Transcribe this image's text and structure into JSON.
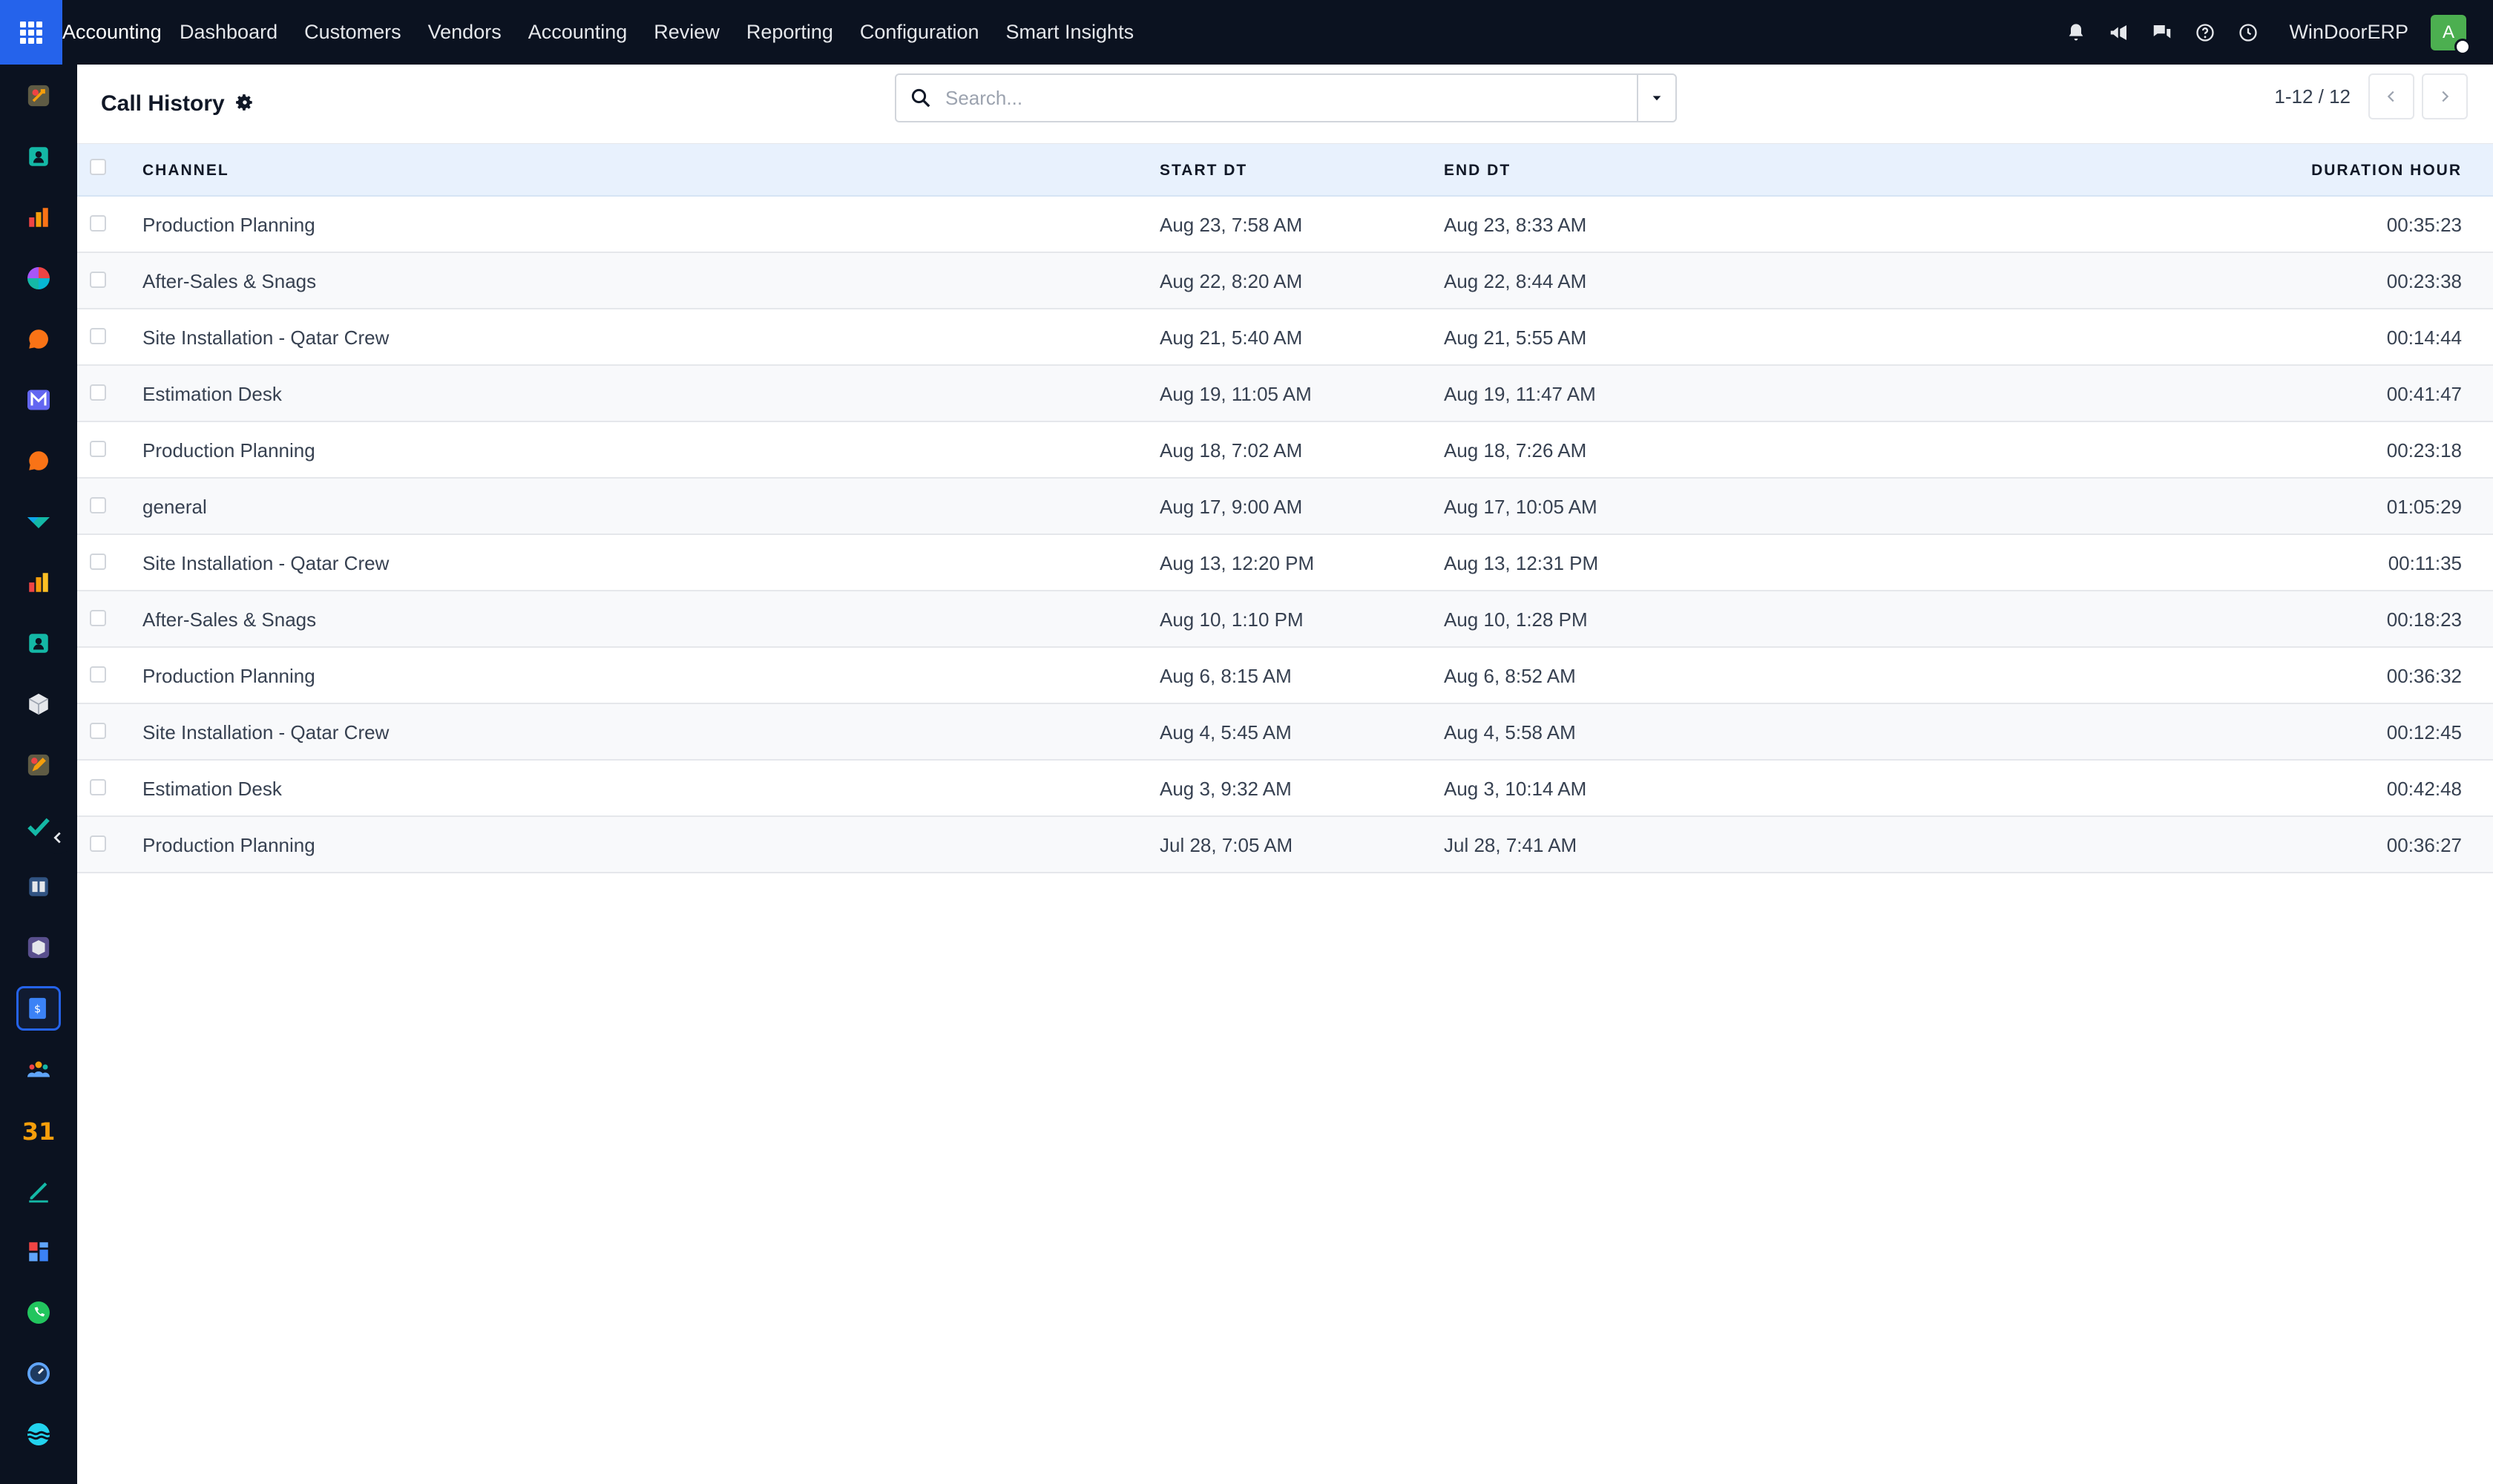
{
  "app": {
    "brand": "Accounting",
    "menu": [
      "Dashboard",
      "Customers",
      "Vendors",
      "Accounting",
      "Review",
      "Reporting",
      "Configuration",
      "Smart Insights"
    ],
    "company": "WinDoorERP",
    "avatar_initial": "A"
  },
  "page": {
    "title": "Call History"
  },
  "search": {
    "placeholder": "Search...",
    "value": ""
  },
  "pager": {
    "range": "1-12 / 12"
  },
  "table": {
    "columns": {
      "channel": "CHANNEL",
      "start": "START DT",
      "end": "END DT",
      "duration": "DURATION HOUR"
    },
    "rows": [
      {
        "channel": "Production Planning",
        "start": "Aug 23, 7:58 AM",
        "end": "Aug 23, 8:33 AM",
        "duration": "00:35:23"
      },
      {
        "channel": "After-Sales & Snags",
        "start": "Aug 22, 8:20 AM",
        "end": "Aug 22, 8:44 AM",
        "duration": "00:23:38"
      },
      {
        "channel": "Site Installation - Qatar Crew",
        "start": "Aug 21, 5:40 AM",
        "end": "Aug 21, 5:55 AM",
        "duration": "00:14:44"
      },
      {
        "channel": "Estimation Desk",
        "start": "Aug 19, 11:05 AM",
        "end": "Aug 19, 11:47 AM",
        "duration": "00:41:47"
      },
      {
        "channel": "Production Planning",
        "start": "Aug 18, 7:02 AM",
        "end": "Aug 18, 7:26 AM",
        "duration": "00:23:18"
      },
      {
        "channel": "general",
        "start": "Aug 17, 9:00 AM",
        "end": "Aug 17, 10:05 AM",
        "duration": "01:05:29"
      },
      {
        "channel": "Site Installation - Qatar Crew",
        "start": "Aug 13, 12:20 PM",
        "end": "Aug 13, 12:31 PM",
        "duration": "00:11:35"
      },
      {
        "channel": "After-Sales & Snags",
        "start": "Aug 10, 1:10 PM",
        "end": "Aug 10, 1:28 PM",
        "duration": "00:18:23"
      },
      {
        "channel": "Production Planning",
        "start": "Aug 6, 8:15 AM",
        "end": "Aug 6, 8:52 AM",
        "duration": "00:36:32"
      },
      {
        "channel": "Site Installation - Qatar Crew",
        "start": "Aug 4, 5:45 AM",
        "end": "Aug 4, 5:58 AM",
        "duration": "00:12:45"
      },
      {
        "channel": "Estimation Desk",
        "start": "Aug 3, 9:32 AM",
        "end": "Aug 3, 10:14 AM",
        "duration": "00:42:48"
      },
      {
        "channel": "Production Planning",
        "start": "Jul 28, 7:05 AM",
        "end": "Jul 28, 7:41 AM",
        "duration": "00:36:27"
      }
    ]
  },
  "sidebar": {
    "items": [
      {
        "icon": "spark-app-icon",
        "color": "#f59e0b"
      },
      {
        "icon": "contacts-app-icon",
        "color": "#14b8a6"
      },
      {
        "icon": "sales-chart-app-icon",
        "color": "#ef4444"
      },
      {
        "icon": "pie-app-icon",
        "color": "#06b6d4"
      },
      {
        "icon": "chat-bubble-app-icon",
        "color": "#f97316"
      },
      {
        "icon": "mail-app-icon",
        "color": "#6366f1"
      },
      {
        "icon": "discuss-app-icon",
        "color": "#f97316"
      },
      {
        "icon": "arrow-app-icon",
        "color": "#14b8a6"
      },
      {
        "icon": "bars-app-icon",
        "color": "#f59e0b"
      },
      {
        "icon": "employees-app-icon",
        "color": "#14b8a6"
      },
      {
        "icon": "cube-app-icon",
        "color": "#e5e7eb"
      },
      {
        "icon": "pen-app-icon",
        "color": "#f59e0b"
      },
      {
        "icon": "check-app-icon",
        "color": "#14b8a6"
      },
      {
        "icon": "book-app-icon",
        "color": "#60a5fa"
      },
      {
        "icon": "box-app-icon",
        "color": "#a78bfa"
      },
      {
        "icon": "invoice-app-icon",
        "color": "#3b82f6"
      },
      {
        "icon": "team-app-icon",
        "color": "#f59e0b"
      },
      {
        "icon": "calendar-app-icon",
        "color": "#f59e0b",
        "label": "31"
      },
      {
        "icon": "sign-app-icon",
        "color": "#14b8a6"
      },
      {
        "icon": "dashboard-app-icon",
        "color": "#3b82f6"
      },
      {
        "icon": "whatsapp-app-icon",
        "color": "#22c55e"
      },
      {
        "icon": "clock-app-icon",
        "color": "#60a5fa"
      },
      {
        "icon": "wave-app-icon",
        "color": "#22d3ee"
      }
    ]
  }
}
